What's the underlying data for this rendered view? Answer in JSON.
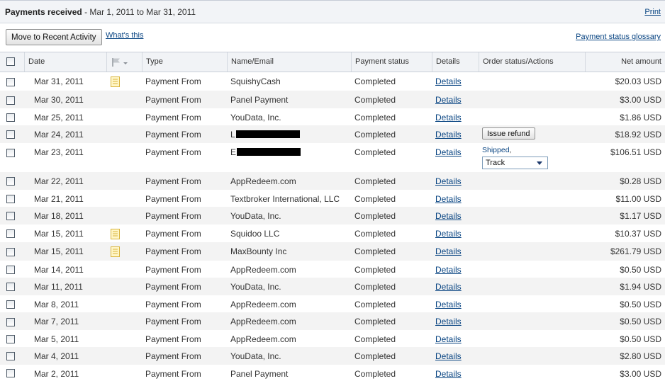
{
  "header": {
    "title": "Payments received",
    "date_range": " - Mar 1, 2011 to Mar 31, 2011",
    "print_label": "Print"
  },
  "toolbar": {
    "move_button": "Move to Recent Activity",
    "whats_this": "What's this",
    "glossary": "Payment status glossary"
  },
  "columns": {
    "date": "Date",
    "type": "Type",
    "name": "Name/Email",
    "status": "Payment status",
    "details": "Details",
    "order": "Order status/Actions",
    "amount": "Net amount"
  },
  "actions": {
    "issue_refund": "Issue refund",
    "shipped": "Shipped",
    "shipped_suffix": ",",
    "track": "Track"
  },
  "rows": [
    {
      "date": "Mar 31, 2011",
      "type": "Payment From",
      "name": "SquishyCash",
      "status": "Completed",
      "details": "Details",
      "amount": "$20.03 USD",
      "note": true
    },
    {
      "date": "Mar 30, 2011",
      "type": "Payment From",
      "name": "Panel Payment",
      "status": "Completed",
      "details": "Details",
      "amount": "$3.00 USD"
    },
    {
      "date": "Mar 25, 2011",
      "type": "Payment From",
      "name": "YouData, Inc.",
      "status": "Completed",
      "details": "Details",
      "amount": "$1.86 USD"
    },
    {
      "date": "Mar 24, 2011",
      "type": "Payment From",
      "name": "L",
      "redacted": true,
      "status": "Completed",
      "details": "Details",
      "amount": "$18.92 USD",
      "action": "refund"
    },
    {
      "date": "Mar 23, 2011",
      "type": "Payment From",
      "name": "E",
      "redacted": true,
      "status": "Completed",
      "details": "Details",
      "amount": "$106.51 USD",
      "action": "shipped"
    },
    {
      "date": "Mar 22, 2011",
      "type": "Payment From",
      "name": "AppRedeem.com",
      "status": "Completed",
      "details": "Details",
      "amount": "$0.28 USD"
    },
    {
      "date": "Mar 21, 2011",
      "type": "Payment From",
      "name": "Textbroker International, LLC",
      "status": "Completed",
      "details": "Details",
      "amount": "$11.00 USD"
    },
    {
      "date": "Mar 18, 2011",
      "type": "Payment From",
      "name": "YouData, Inc.",
      "status": "Completed",
      "details": "Details",
      "amount": "$1.17 USD"
    },
    {
      "date": "Mar 15, 2011",
      "type": "Payment From",
      "name": "Squidoo LLC",
      "status": "Completed",
      "details": "Details",
      "amount": "$10.37 USD",
      "note": true
    },
    {
      "date": "Mar 15, 2011",
      "type": "Payment From",
      "name": "MaxBounty Inc",
      "status": "Completed",
      "details": "Details",
      "amount": "$261.79 USD",
      "note": true
    },
    {
      "date": "Mar 14, 2011",
      "type": "Payment From",
      "name": "AppRedeem.com",
      "status": "Completed",
      "details": "Details",
      "amount": "$0.50 USD"
    },
    {
      "date": "Mar 11, 2011",
      "type": "Payment From",
      "name": "YouData, Inc.",
      "status": "Completed",
      "details": "Details",
      "amount": "$1.94 USD"
    },
    {
      "date": "Mar 8, 2011",
      "type": "Payment From",
      "name": "AppRedeem.com",
      "status": "Completed",
      "details": "Details",
      "amount": "$0.50 USD"
    },
    {
      "date": "Mar 7, 2011",
      "type": "Payment From",
      "name": "AppRedeem.com",
      "status": "Completed",
      "details": "Details",
      "amount": "$0.50 USD"
    },
    {
      "date": "Mar 5, 2011",
      "type": "Payment From",
      "name": "AppRedeem.com",
      "status": "Completed",
      "details": "Details",
      "amount": "$0.50 USD"
    },
    {
      "date": "Mar 4, 2011",
      "type": "Payment From",
      "name": "YouData, Inc.",
      "status": "Completed",
      "details": "Details",
      "amount": "$2.80 USD"
    },
    {
      "date": "Mar 2, 2011",
      "type": "Payment From",
      "name": "Panel Payment",
      "status": "Completed",
      "details": "Details",
      "amount": "$3.00 USD"
    }
  ]
}
